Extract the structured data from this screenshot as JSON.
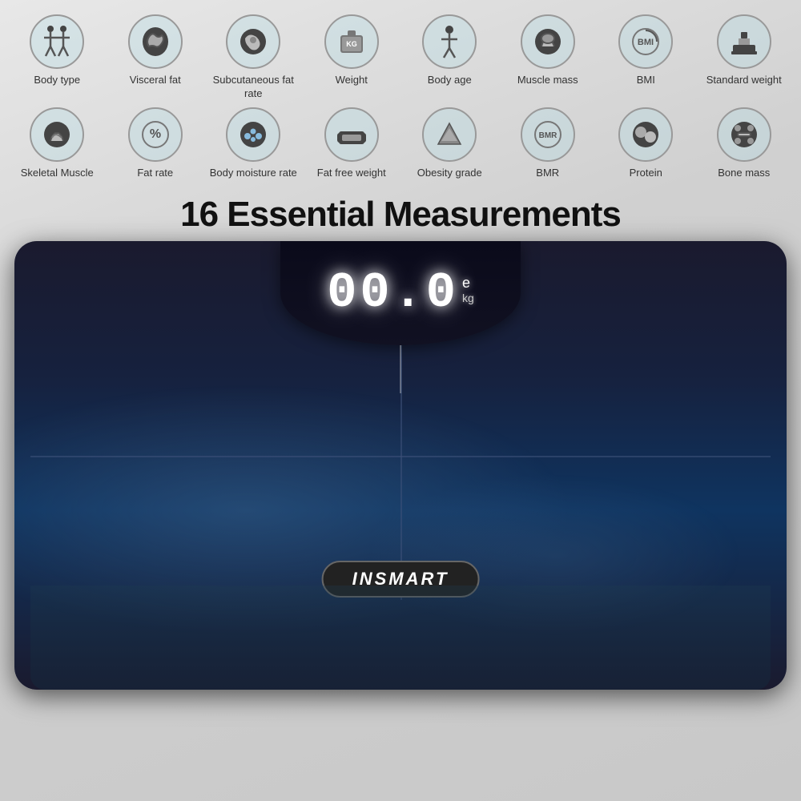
{
  "background": "#d0d0d0",
  "icons_row1": [
    {
      "label": "Body type",
      "icon": "body-type-icon"
    },
    {
      "label": "Visceral fat",
      "icon": "visceral-fat-icon"
    },
    {
      "label": "Subcutaneous fat rate",
      "icon": "subcutaneous-icon"
    },
    {
      "label": "Weight",
      "icon": "weight-icon"
    },
    {
      "label": "Body age",
      "icon": "body-age-icon"
    },
    {
      "label": "Muscle mass",
      "icon": "muscle-mass-icon"
    },
    {
      "label": "BMI",
      "icon": "bmi-icon"
    },
    {
      "label": "Standard weight",
      "icon": "standard-weight-icon"
    }
  ],
  "icons_row2": [
    {
      "label": "Skeletal Muscle",
      "icon": "skeletal-muscle-icon"
    },
    {
      "label": "Fat rate",
      "icon": "fat-rate-icon"
    },
    {
      "label": "Body moisture rate",
      "icon": "body-moisture-icon"
    },
    {
      "label": "Fat free weight",
      "icon": "fat-free-weight-icon"
    },
    {
      "label": "Obesity grade",
      "icon": "obesity-grade-icon"
    },
    {
      "label": "BMR",
      "icon": "bmr-icon"
    },
    {
      "label": "Protein",
      "icon": "protein-icon"
    },
    {
      "label": "Bone mass",
      "icon": "bone-mass-icon"
    }
  ],
  "heading": "16 Essential Measurements",
  "scale": {
    "display_value": "00.0",
    "display_superscript": "e",
    "display_unit": "kg",
    "brand": "INSMART"
  }
}
